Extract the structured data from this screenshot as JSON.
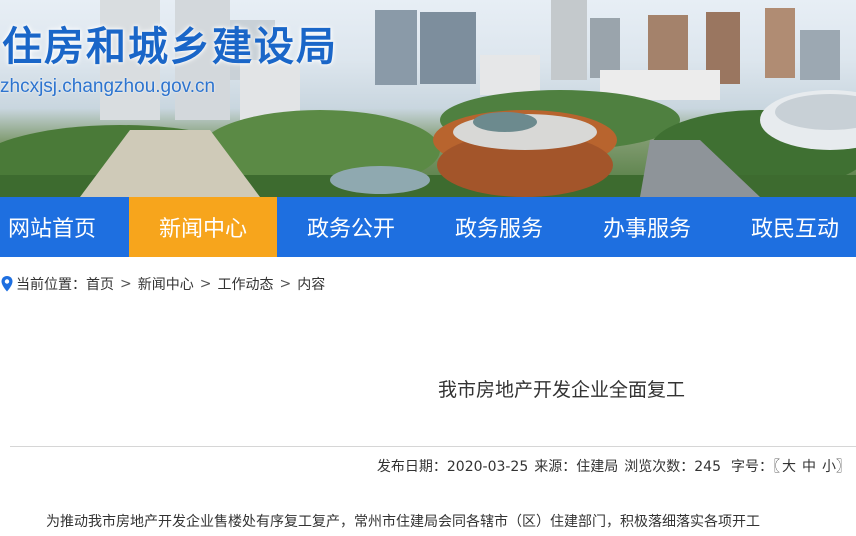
{
  "header": {
    "site_title": "住房和城乡建设局",
    "site_url": "zhcxjsj.changzhou.gov.cn"
  },
  "nav": {
    "items": [
      {
        "label": "网站首页"
      },
      {
        "label": "新闻中心"
      },
      {
        "label": "政务公开"
      },
      {
        "label": "政务服务"
      },
      {
        "label": "办事服务"
      },
      {
        "label": "政民互动"
      }
    ],
    "active_color": "#f7a51c",
    "bar_color": "#1e6fe0"
  },
  "breadcrumb": {
    "prefix": "当前位置：",
    "items": [
      "首页",
      "新闻中心",
      "工作动态",
      "内容"
    ],
    "separator": ">"
  },
  "article": {
    "title": "我市房地产开发企业全面复工",
    "meta": {
      "date_label": "发布日期：2020-03-25",
      "source_label": "来源：住建局",
      "views_label": "浏览次数：245",
      "font_label": "字号：〖",
      "size_large": "大",
      "size_medium": "中",
      "size_small": "小",
      "font_close": "〗"
    },
    "body_first_line": "为推动我市房地产开发企业售楼处有序复工复产，常州市住建局会同各辖市（区）住建部门，积极落细落实各项开工"
  }
}
